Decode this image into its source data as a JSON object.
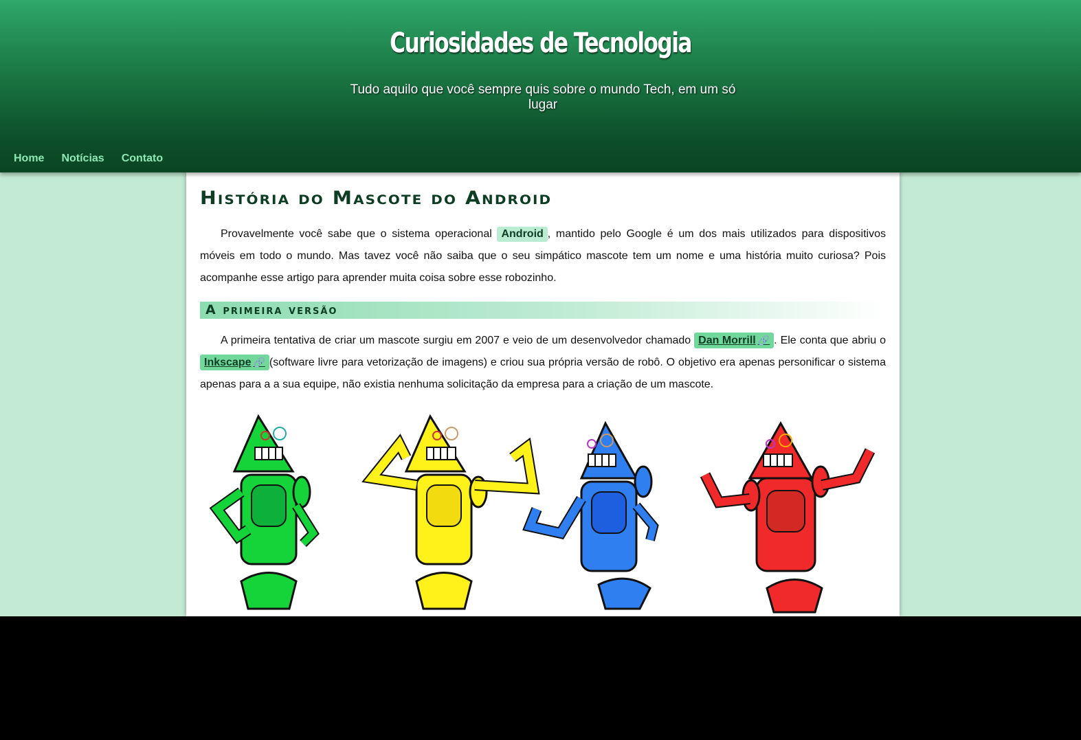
{
  "header": {
    "title": "Curiosidades de Tecnologia",
    "subtitle": "Tudo aquilo que você sempre quis sobre o mundo Tech, em um só lugar"
  },
  "nav": {
    "items": [
      "Home",
      "Notícias",
      "Contato"
    ]
  },
  "article": {
    "title": "História do Mascote do Android",
    "intro": {
      "before": "Provavelmente você sabe que o sistema operacional ",
      "tag": "Android",
      "after": ", mantido pelo Google é um dos mais utilizados para dispositivos móveis em todo o mundo. Mas tavez você não saiba que o seu simpático mascote tem um nome e uma história muito curiosa? Pois acompanhe esse artigo para aprender muita coisa sobre esse robozinho."
    },
    "section1": {
      "title": "A primeira versão",
      "p_before": "A primeira tentativa de criar um mascote surgiu em 2007 e veio de um desenvolvedor chamado ",
      "link1": "Dan Morrill",
      "p_middle": ". Ele conta que abriu o ",
      "link2": "Inkscape",
      "p_after": "(software livre para vetorização de imagens) e criou sua própria versão de robô. O objetivo era apenas personificar o sistema apenas para a a sua equipe, não existia nenhuma solicitação da empresa para a criação de um mascote."
    },
    "link_icon": "paperclip-icon",
    "robots": {
      "colors": [
        "#15d43a",
        "#fff21a",
        "#2f7ff0",
        "#f02a2a"
      ]
    }
  },
  "colors": {
    "header_top": "#2fa86a",
    "header_bottom": "#0a4524",
    "page_bg": "#c3ead3",
    "nav_link": "#8ee8b4",
    "tag_bg": "#b9ecd1",
    "link_bg": "#72d79b"
  }
}
